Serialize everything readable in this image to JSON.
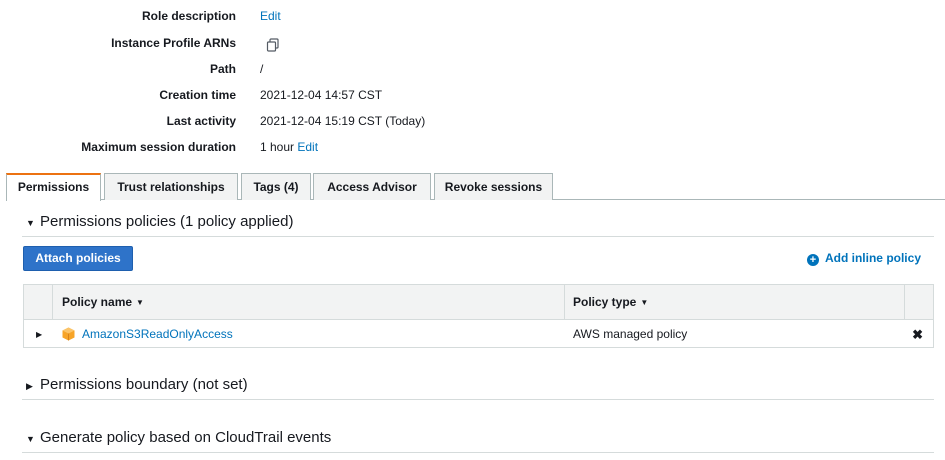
{
  "summary": {
    "role_description": {
      "label": "Role description",
      "value": "Edit"
    },
    "instance_profile_arns": {
      "label": "Instance Profile ARNs",
      "icon": "copy-icon"
    },
    "path": {
      "label": "Path",
      "value": "/"
    },
    "creation_time": {
      "label": "Creation time",
      "value": "2021-12-04 14:57 CST"
    },
    "last_activity": {
      "label": "Last activity",
      "value": "2021-12-04 15:19 CST (Today)"
    },
    "max_session": {
      "label": "Maximum session duration",
      "value": "1 hour",
      "edit": "Edit"
    }
  },
  "tabs": [
    {
      "label": "Permissions",
      "active": true
    },
    {
      "label": "Trust relationships"
    },
    {
      "label": "Tags (4)"
    },
    {
      "label": "Access Advisor"
    },
    {
      "label": "Revoke sessions"
    }
  ],
  "permissions_policies": {
    "heading": "Permissions policies (1 policy applied)",
    "attach_button": "Attach policies",
    "add_inline": "Add inline policy",
    "table": {
      "headers": [
        "Policy name",
        "Policy type"
      ],
      "rows": [
        {
          "name": "AmazonS3ReadOnlyAccess",
          "type": "AWS managed policy",
          "icon": "aws-policy-cube-icon",
          "remove": "✖"
        }
      ]
    }
  },
  "permissions_boundary": {
    "heading": "Permissions boundary (not set)"
  },
  "generate_policy": {
    "heading": "Generate policy based on CloudTrail events"
  },
  "colors": {
    "link": "#0073bb",
    "button": "#2e73c9",
    "active_tab": "#ec7211"
  }
}
